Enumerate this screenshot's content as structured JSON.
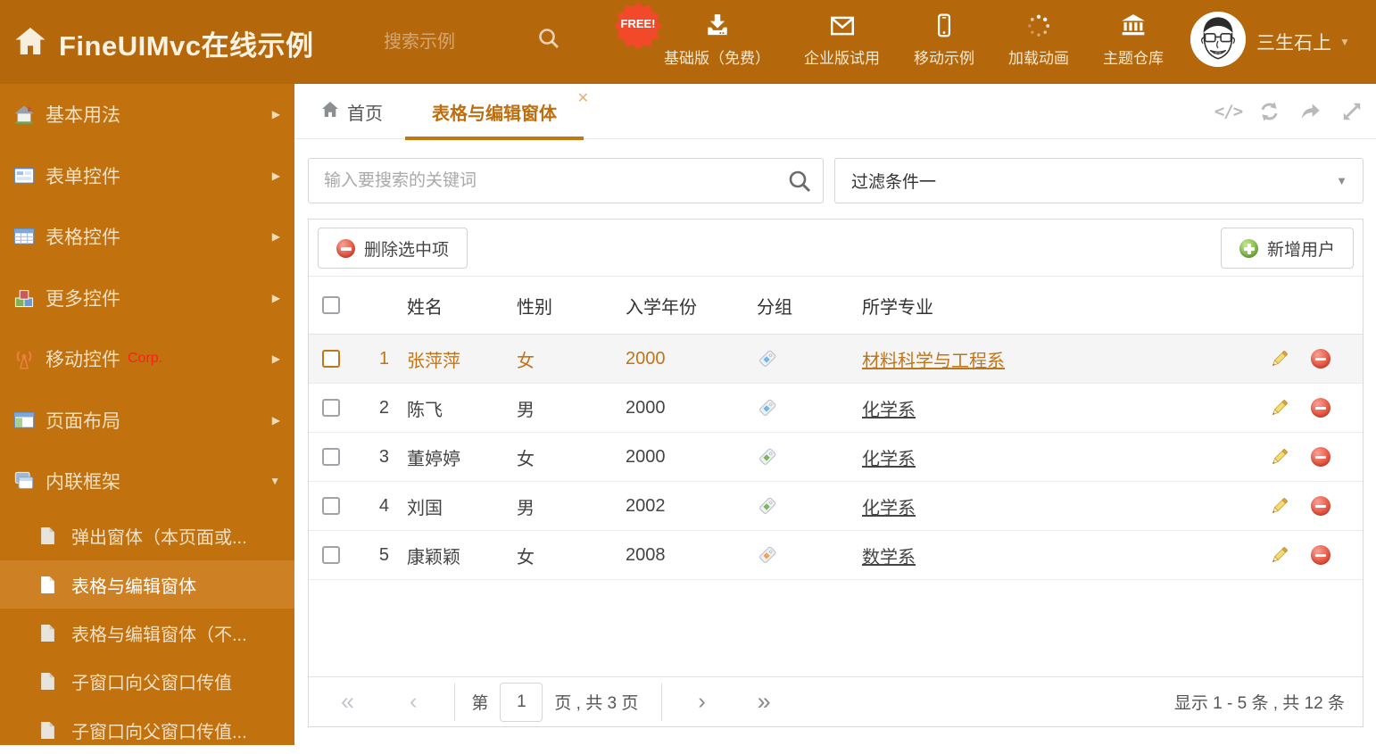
{
  "header": {
    "title": "FineUIMvc在线示例",
    "search_placeholder": "搜索示例",
    "free_badge": "FREE!",
    "nav": [
      {
        "label": "基础版（免费）",
        "icon": "download-icon"
      },
      {
        "label": "企业版试用",
        "icon": "mail-icon"
      },
      {
        "label": "移动示例",
        "icon": "mobile-icon"
      },
      {
        "label": "加载动画",
        "icon": "spinner-icon"
      },
      {
        "label": "主题仓库",
        "icon": "bank-icon"
      }
    ],
    "username": "三生石上"
  },
  "sidebar": {
    "items": [
      {
        "label": "基本用法",
        "icon": "home-icon"
      },
      {
        "label": "表单控件",
        "icon": "form-icon"
      },
      {
        "label": "表格控件",
        "icon": "table-icon"
      },
      {
        "label": "更多控件",
        "icon": "cubes-icon"
      },
      {
        "label": "移动控件",
        "badge": "Corp.",
        "icon": "antenna-icon"
      },
      {
        "label": "页面布局",
        "icon": "layout-icon"
      },
      {
        "label": "内联框架",
        "icon": "frames-icon"
      }
    ],
    "subitems": [
      {
        "label": "弹出窗体（本页面或..."
      },
      {
        "label": "表格与编辑窗体"
      },
      {
        "label": "表格与编辑窗体（不..."
      },
      {
        "label": "子窗口向父窗口传值"
      },
      {
        "label": "子窗口向父窗口传值..."
      }
    ]
  },
  "tabs": {
    "home": "首页",
    "active": "表格与编辑窗体"
  },
  "filter": {
    "search_placeholder": "输入要搜索的关键词",
    "dropdown_value": "过滤条件一"
  },
  "grid": {
    "delete_button": "删除选中项",
    "add_button": "新增用户",
    "columns": {
      "name": "姓名",
      "gender": "性别",
      "year": "入学年份",
      "group": "分组",
      "major": "所学专业"
    },
    "rows": [
      {
        "num": "1",
        "name": "张萍萍",
        "gender": "女",
        "year": "2000",
        "tag": "tag-blue",
        "major": "材料科学与工程系"
      },
      {
        "num": "2",
        "name": "陈飞",
        "gender": "男",
        "year": "2000",
        "tag": "tag-blue",
        "major": "化学系"
      },
      {
        "num": "3",
        "name": "董婷婷",
        "gender": "女",
        "year": "2000",
        "tag": "tag-green",
        "major": "化学系"
      },
      {
        "num": "4",
        "name": "刘国",
        "gender": "男",
        "year": "2002",
        "tag": "tag-green",
        "major": "化学系"
      },
      {
        "num": "5",
        "name": "康颖颖",
        "gender": "女",
        "year": "2008",
        "tag": "tag-orange",
        "major": "数学系"
      }
    ]
  },
  "pagination": {
    "prefix": "第",
    "page": "1",
    "suffix": "页 , 共 3 页",
    "summary": "显示 1 - 5 条 , 共 12 条"
  },
  "colors": {
    "header_bg": "#B5670B",
    "sidebar_bg": "#C1710D",
    "sidebar_active_bg": "#CD8124",
    "accent_orange": "#BF751A",
    "tab_underline": "#C4770F",
    "free_badge_red": "#F2492B",
    "delete_red": "#E14B38",
    "add_green": "#7DB843",
    "tag_blue": "#6FB9E8",
    "tag_green": "#7CB857",
    "tag_orange": "#F2A456"
  }
}
